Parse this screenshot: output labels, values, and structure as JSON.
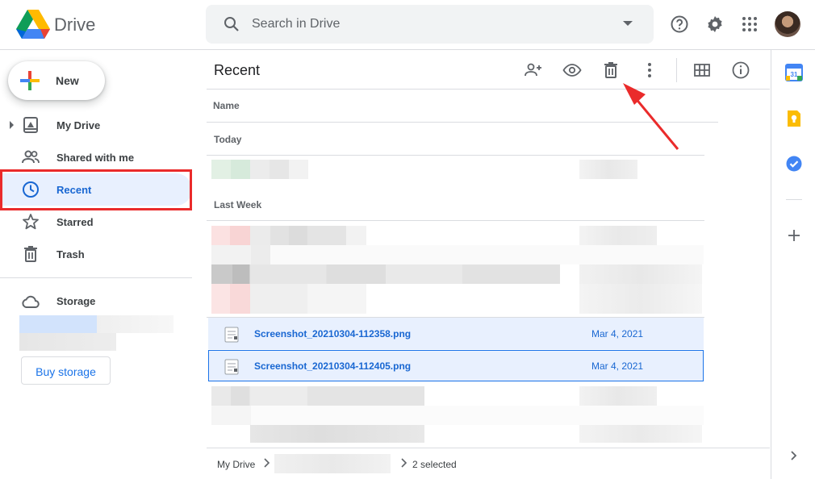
{
  "header": {
    "brand": "Drive",
    "search_placeholder": "Search in Drive",
    "icons": [
      "help-icon",
      "settings-icon",
      "apps-icon"
    ]
  },
  "sidebar": {
    "new_label": "New",
    "items": [
      {
        "label": "My Drive",
        "icon": "my-drive-icon"
      },
      {
        "label": "Shared with me",
        "icon": "shared-icon"
      },
      {
        "label": "Recent",
        "icon": "clock-icon",
        "active": true
      },
      {
        "label": "Starred",
        "icon": "star-icon"
      },
      {
        "label": "Trash",
        "icon": "trash-icon"
      }
    ],
    "storage_label": "Storage",
    "buy_storage_label": "Buy storage"
  },
  "main": {
    "title": "Recent",
    "toolbar_icons": [
      "share-icon",
      "preview-icon",
      "trash-icon",
      "more-icon",
      "grid-view-icon",
      "info-icon"
    ],
    "column_name": "Name",
    "groups": [
      "Today",
      "Last Week"
    ],
    "files": [
      {
        "name": "Screenshot_20210304-112358.png",
        "date": "Mar 4, 2021"
      },
      {
        "name": "Screenshot_20210304-112405.png",
        "date": "Mar 4, 2021"
      }
    ]
  },
  "footer": {
    "root": "My Drive",
    "selected": "2 selected"
  },
  "colors": {
    "accent": "#1a73e8",
    "selected_bg": "#e8f0fe",
    "annotation_red": "#ea2b2b"
  }
}
